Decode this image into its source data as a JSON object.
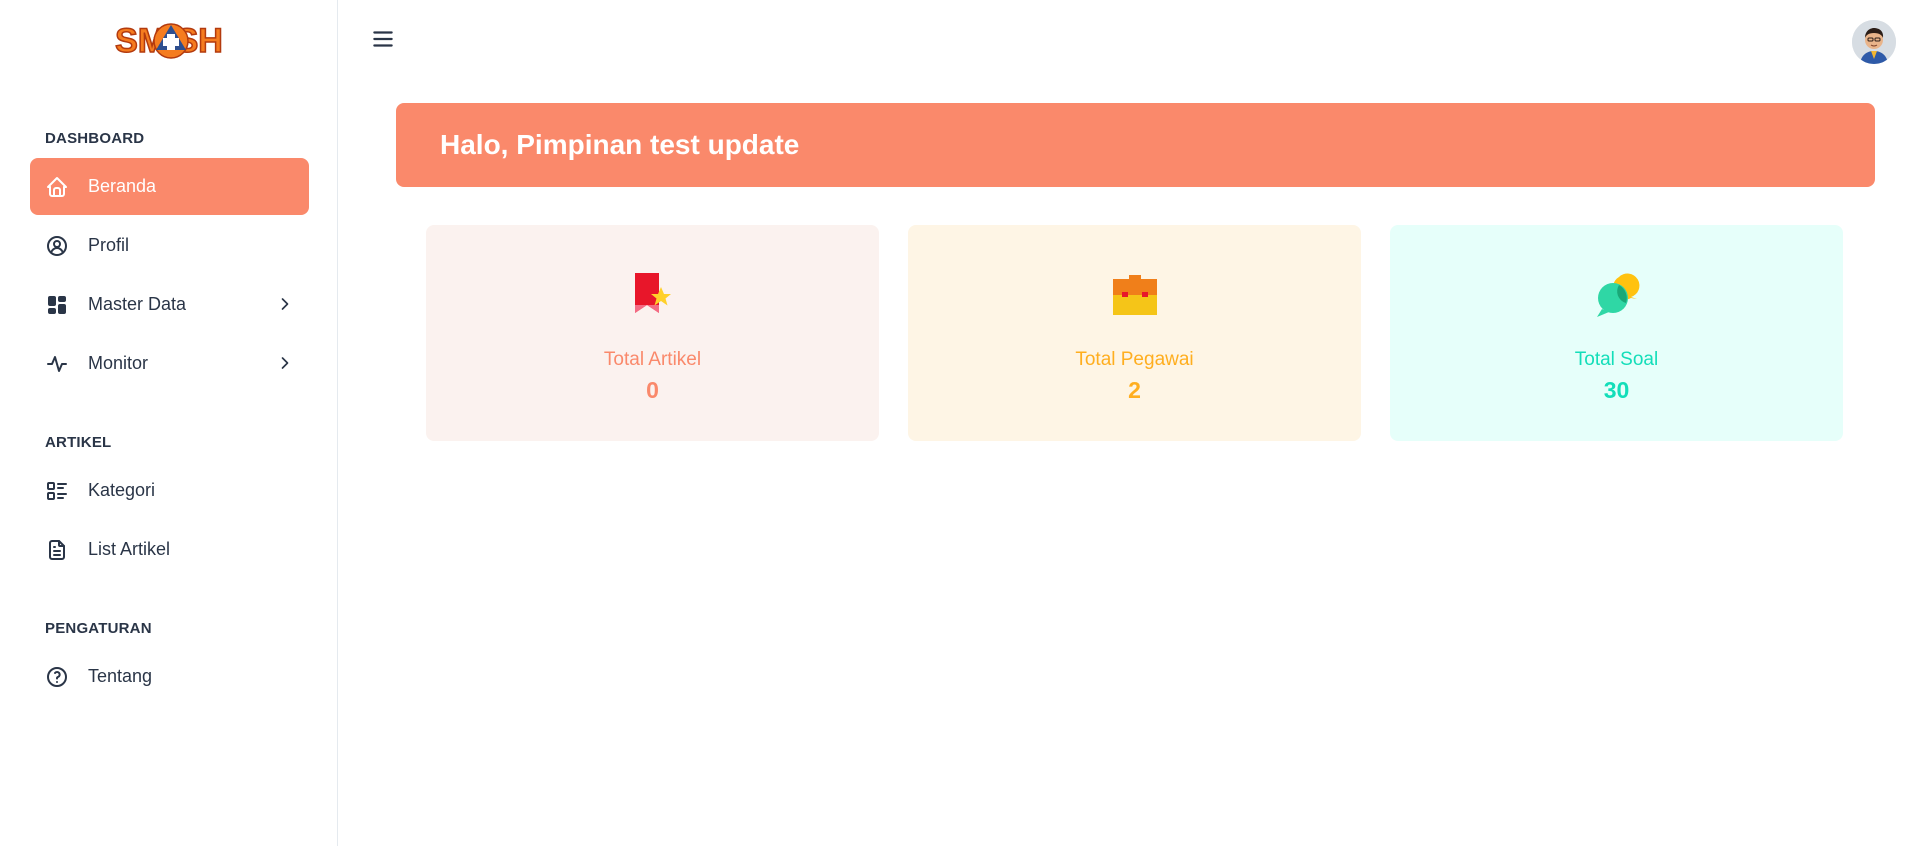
{
  "brand": {
    "logo_text": "SMASH"
  },
  "colors": {
    "primary": "#fa896b",
    "text": "#2a3547",
    "card_artikel_bg": "#fbf2ef",
    "card_artikel_text": "#fa896b",
    "card_pegawai_bg": "#fef5e5",
    "card_pegawai_text": "#ffae1f",
    "card_soal_bg": "#e6fffa",
    "card_soal_text": "#13deb9"
  },
  "sidebar": {
    "sections": [
      {
        "title": "DASHBOARD",
        "items": [
          {
            "label": "Beranda",
            "icon": "home-icon",
            "active": true
          },
          {
            "label": "Profil",
            "icon": "user-circle-icon"
          },
          {
            "label": "Master Data",
            "icon": "layout-dashboard-icon",
            "has_children": true
          },
          {
            "label": "Monitor",
            "icon": "activity-pulse-icon",
            "has_children": true
          }
        ]
      },
      {
        "title": "ARTIKEL",
        "items": [
          {
            "label": "Kategori",
            "icon": "list-details-icon"
          },
          {
            "label": "List Artikel",
            "icon": "file-text-icon"
          }
        ]
      },
      {
        "title": "PENGATURAN",
        "items": [
          {
            "label": "Tentang",
            "icon": "help-circle-icon"
          }
        ]
      }
    ]
  },
  "header": {
    "menu_icon": "hamburger-menu-icon",
    "avatar_icon": "user-avatar-icon"
  },
  "banner": {
    "greeting": "Halo, Pimpinan test update"
  },
  "cards": [
    {
      "label": "Total Artikel",
      "value": "0",
      "icon": "award-ribbon-icon"
    },
    {
      "label": "Total Pegawai",
      "value": "2",
      "icon": "briefcase-icon"
    },
    {
      "label": "Total Soal",
      "value": "30",
      "icon": "chat-bubbles-icon"
    }
  ]
}
